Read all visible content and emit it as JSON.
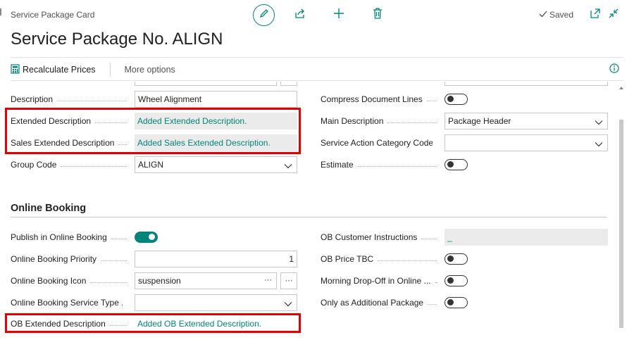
{
  "header": {
    "caption": "Service Package Card",
    "title": "Service Package No. ALIGN",
    "saved_label": "Saved"
  },
  "action_bar": {
    "recalculate_label": "Recalculate Prices",
    "more_options_label": "More options"
  },
  "general": {
    "left": {
      "description_label": "Description",
      "description_value": "Wheel Alignment",
      "extended_description_label": "Extended Description",
      "extended_description_value": "Added Extended Description.",
      "sales_extended_description_label": "Sales Extended Description",
      "sales_extended_description_value": "Added Sales Extended Description.",
      "group_code_label": "Group Code",
      "group_code_value": "ALIGN"
    },
    "right": {
      "compress_label": "Compress Document Lines",
      "compress_on": false,
      "main_description_label": "Main Description",
      "main_description_value": "Package Header",
      "service_action_label": "Service Action Category Code",
      "service_action_value": "",
      "estimate_label": "Estimate",
      "estimate_on": false
    }
  },
  "online_booking": {
    "section_title": "Online Booking",
    "left": {
      "publish_label": "Publish in Online Booking",
      "publish_on": true,
      "priority_label": "Online Booking Priority",
      "priority_value": "1",
      "icon_label": "Online Booking Icon",
      "icon_value": "suspension",
      "icon_lookup": "···",
      "service_type_label": "Online Booking Service Type ...",
      "service_type_value": "",
      "ob_extended_label": "OB Extended Description",
      "ob_extended_value": "Added OB Extended Description."
    },
    "right": {
      "customer_instructions_label": "OB Customer Instructions",
      "customer_instructions_value": "_",
      "price_tbc_label": "OB Price TBC",
      "price_tbc_on": false,
      "morning_dropoff_label": "Morning Drop-Off in Online ...",
      "morning_dropoff_on": false,
      "additional_label": "Only as Additional Package",
      "additional_on": false
    }
  },
  "colors": {
    "accent": "#00857a",
    "highlight_border": "#e60000",
    "readonly_bg": "#ebebeb"
  },
  "icons": [
    "edit-icon",
    "share-icon",
    "new-icon",
    "delete-icon",
    "checkmark-icon",
    "open-new-window-icon",
    "collapse-icon",
    "calculator-icon",
    "info-icon",
    "chevron-down-icon",
    "ellipsis-icon"
  ]
}
